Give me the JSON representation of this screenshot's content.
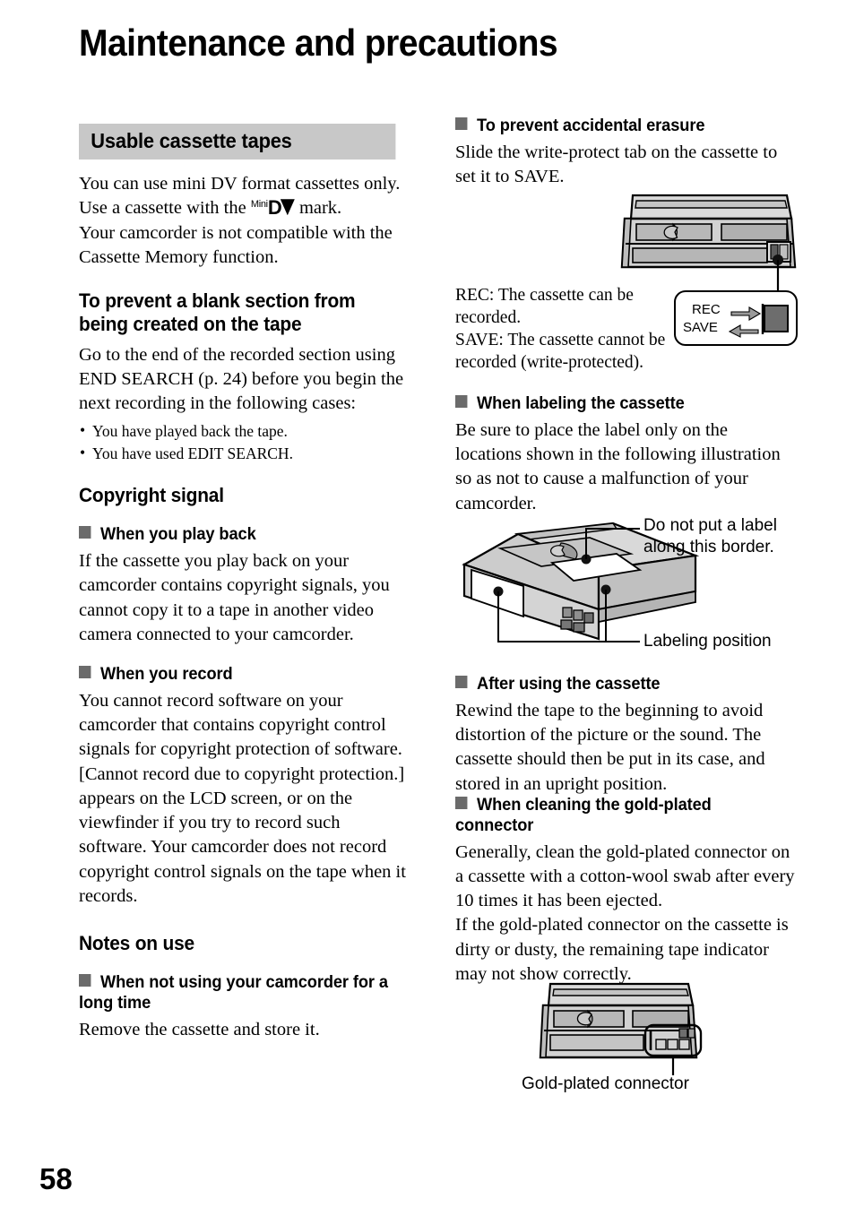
{
  "page": {
    "title": "Maintenance and precautions",
    "number": "58"
  },
  "left_column": {
    "section_bar": "Usable cassette tapes",
    "intro": {
      "line1": "You can use mini DV format cassettes only.",
      "line2_before": "Use a cassette with the ",
      "mini_label": "Mini",
      "dv_label": "DV",
      "line2_after": " mark.",
      "line3": "Your camcorder is not compatible with the Cassette Memory function."
    },
    "blank_section": {
      "heading": "To prevent a blank section from being created on the tape",
      "body": "Go to the end of the recorded section using END SEARCH (p. 24) before you begin the next recording in the following cases:",
      "bullets": [
        "You have played back the tape.",
        "You have used EDIT SEARCH."
      ]
    },
    "copyright_signal": {
      "heading": "Copyright signal",
      "play_back": {
        "heading": "When you play back",
        "body": "If the cassette you play back on your camcorder contains copyright signals, you cannot copy it to a tape in another video camera connected to your camcorder."
      },
      "record": {
        "heading": "When you record",
        "body": "You cannot record software on your camcorder that contains copyright control signals for copyright protection of software. [Cannot record due to copyright protection.] appears on the LCD screen, or on the viewfinder if you try to record such software. Your camcorder does not record copyright control signals on the tape when it records."
      }
    },
    "notes_on_use": {
      "heading": "Notes on use",
      "not_using": {
        "heading": "When not using your camcorder for a long time",
        "body": "Remove the cassette and store it."
      }
    }
  },
  "right_column": {
    "accidental_erasure": {
      "heading": "To prevent accidental erasure",
      "body": "Slide the write-protect tab on the cassette to set it to SAVE.",
      "caption_line1": "REC: The cassette can be",
      "caption_line2": "recorded.",
      "caption_line3": "SAVE: The cassette cannot be",
      "caption_line4": "recorded (write-protected).",
      "detail_rec": "REC",
      "detail_save": "SAVE"
    },
    "labeling": {
      "heading": "When labeling the cassette",
      "body": "Be sure to place the label only on the locations shown in the following illustration so as not to cause a malfunction of your camcorder.",
      "callout_border_line1": "Do not put a label",
      "callout_border_line2": "along this border.",
      "callout_position": "Labeling position"
    },
    "after_using": {
      "heading": "After using the cassette",
      "body": "Rewind the tape to the beginning to avoid distortion of the picture or the sound. The cassette should then be put in its case, and stored in an upright position."
    },
    "cleaning": {
      "heading": "When cleaning the gold-plated connector",
      "body_p1": "Generally, clean the gold-plated connector on a cassette with a cotton-wool swab after every 10 times it has been ejected.",
      "body_p2": "If the gold-plated connector on the cassette is dirty or dusty, the remaining tape indicator may not show correctly.",
      "caption": "Gold-plated connector"
    }
  },
  "colors": {
    "section_bar_bg": "#c8c8c8",
    "square_bullet": "#6b6b6b",
    "illustration_light": "#d4d4d4",
    "illustration_mid": "#b0b0b0",
    "illustration_dark": "#8a8a8a"
  }
}
